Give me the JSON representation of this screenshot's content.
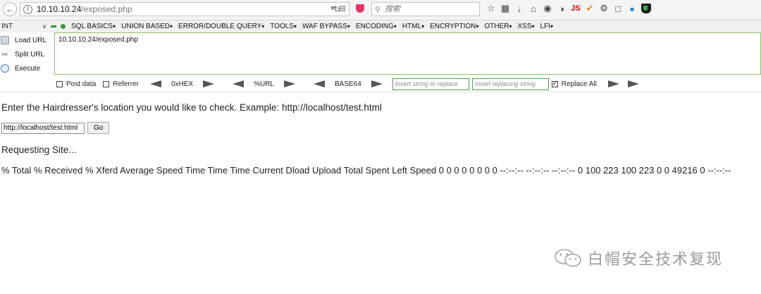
{
  "browser": {
    "url_host": "10.10.10.24",
    "url_path": "/exposed.php",
    "search_placeholder": "搜索",
    "toolbar_js_label": "JS"
  },
  "hackbar": {
    "int_label": "INT",
    "menus": [
      "SQL BASICS",
      "UNION BASED",
      "ERROR/DOUBLE QUERY",
      "TOOLS",
      "WAF BYPASS",
      "ENCODING",
      "HTML",
      "ENCRYPTION",
      "OTHER",
      "XSS",
      "LFI"
    ],
    "load_url_label": "Load URL",
    "split_url_label": "Split URL",
    "execute_label": "Execute",
    "url_value": "10.10.10.24/exposed.php",
    "post_data_label": "Post data",
    "referrer_label": "Referrer",
    "hex_label": "0xHEX",
    "url_enc_label": "%URL",
    "base64_label": "BASE64",
    "replace_placeholder": "Insert string to replace",
    "replacing_placeholder": "Insert replacing string",
    "replace_all_label": "Replace All"
  },
  "page": {
    "prompt": "Enter the Hairdresser's location you would like to check. Example: http://localhost/test.html",
    "input_value": "http://localhost/test.html",
    "go_label": "Go",
    "requesting": "Requesting Site...",
    "curl_output": "% Total % Received % Xferd Average Speed Time Time Time Current Dload Upload Total Spent Left Speed 0 0 0 0 0 0 0 0 --:--:-- --:--:-- --:--:-- 0 100 223 100 223 0 0 49216 0 --:--:--"
  },
  "watermark": {
    "text": "白帽安全技术复现"
  }
}
